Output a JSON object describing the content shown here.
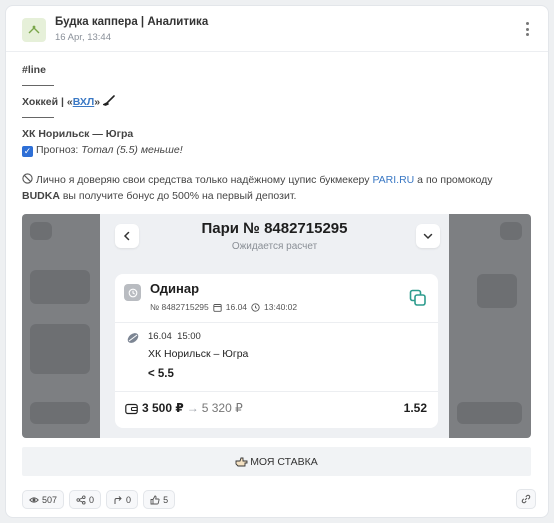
{
  "header": {
    "channel_name": "Будка каппера | Аналитика",
    "date": "16 Apr, 13:44"
  },
  "post": {
    "hashtag": "#line",
    "league_prefix": "Хоккей | «",
    "league_link": "ВХЛ",
    "league_suffix": "»",
    "match": "ХК Норильск — Югра",
    "forecast_label": "Прогноз: ",
    "forecast_value": "Тотал (5.5) меньше!",
    "promo_text_1": "Лично я доверяю свои средства только надёжному цупис букмекеру ",
    "promo_link": "PARI.RU",
    "promo_text_2": " а по промокоду",
    "promo_code": "BUDKA",
    "promo_text_3": " вы получите бонус до 500% на первый депозит."
  },
  "bet": {
    "title": "Пари № 8482715295",
    "status": "Ожидается расчет",
    "type": "Одинар",
    "number": "№ 8482715295",
    "date": "16.04",
    "time": "13:40:02",
    "event_date": "16.04",
    "event_time": "15:00",
    "teams": "ХК Норильск – Югра",
    "pick": "< 5.5",
    "stake": "3 500 ₽",
    "arrow": "→",
    "payout": "5 320 ₽",
    "odds": "1.52"
  },
  "my_bet_label": "МОЯ СТАВКА",
  "footer": {
    "views": "507",
    "shares": "0",
    "forwards": "0",
    "likes": "5"
  },
  "colors": {
    "link": "#3a78c4",
    "checkbox": "#2e6fd6"
  }
}
